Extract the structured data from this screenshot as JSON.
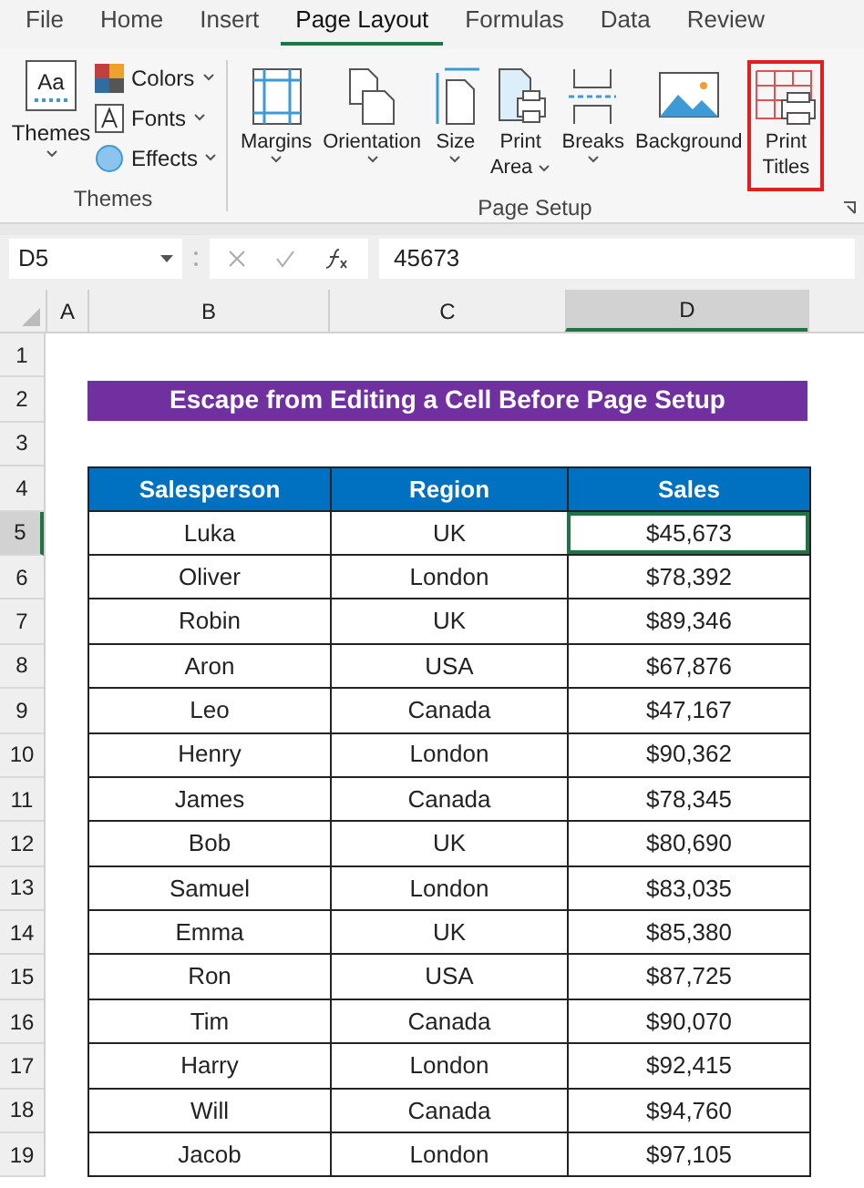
{
  "menu_tabs": [
    {
      "label": "File",
      "selected": false
    },
    {
      "label": "Home",
      "selected": false
    },
    {
      "label": "Insert",
      "selected": false
    },
    {
      "label": "Page Layout",
      "selected": true
    },
    {
      "label": "Formulas",
      "selected": false
    },
    {
      "label": "Data",
      "selected": false
    },
    {
      "label": "Review",
      "selected": false
    }
  ],
  "ribbon": {
    "themes_group": {
      "label": "Themes",
      "themes_button": {
        "icon_text": "Aa",
        "label": "Themes",
        "dropdown": true
      },
      "small_buttons": [
        {
          "label": "Colors",
          "dropdown": true
        },
        {
          "label": "Fonts",
          "dropdown": true
        },
        {
          "label": "Effects",
          "dropdown": true
        }
      ]
    },
    "page_setup_group": {
      "label": "Page Setup",
      "buttons": [
        {
          "lines": [
            "Margins"
          ],
          "dropdown": true,
          "highlighted": false
        },
        {
          "lines": [
            "Orientation"
          ],
          "dropdown": true,
          "highlighted": false
        },
        {
          "lines": [
            "Size"
          ],
          "dropdown": true,
          "highlighted": false
        },
        {
          "lines": [
            "Print",
            "Area"
          ],
          "dropdown": true,
          "highlighted": false
        },
        {
          "lines": [
            "Breaks"
          ],
          "dropdown": true,
          "highlighted": false
        },
        {
          "lines": [
            "Background"
          ],
          "dropdown": false,
          "highlighted": false
        },
        {
          "lines": [
            "Print",
            "Titles"
          ],
          "dropdown": false,
          "highlighted": true
        }
      ]
    }
  },
  "formula_bar": {
    "name_box": "D5",
    "value": "45673"
  },
  "columns": [
    {
      "label": "A",
      "selected": false
    },
    {
      "label": "B",
      "selected": false
    },
    {
      "label": "C",
      "selected": false
    },
    {
      "label": "D",
      "selected": true
    }
  ],
  "row_numbers": [
    {
      "label": "1",
      "selected": false
    },
    {
      "label": "2",
      "selected": false
    },
    {
      "label": "3",
      "selected": false
    },
    {
      "label": "4",
      "selected": false
    },
    {
      "label": "5",
      "selected": true
    },
    {
      "label": "6",
      "selected": false
    },
    {
      "label": "7",
      "selected": false
    },
    {
      "label": "8",
      "selected": false
    },
    {
      "label": "9",
      "selected": false
    },
    {
      "label": "10",
      "selected": false
    },
    {
      "label": "11",
      "selected": false
    },
    {
      "label": "12",
      "selected": false
    },
    {
      "label": "13",
      "selected": false
    },
    {
      "label": "14",
      "selected": false
    },
    {
      "label": "15",
      "selected": false
    },
    {
      "label": "16",
      "selected": false
    },
    {
      "label": "17",
      "selected": false
    },
    {
      "label": "18",
      "selected": false
    },
    {
      "label": "19",
      "selected": false
    }
  ],
  "sheet_title": "Escape from Editing a Cell Before Page Setup",
  "table": {
    "columns": [
      "Salesperson",
      "Region",
      "Sales"
    ],
    "rows": [
      {
        "cells": [
          "Luka",
          "UK",
          "$45,673"
        ],
        "active": [
          false,
          false,
          true
        ]
      },
      {
        "cells": [
          "Oliver",
          "London",
          "$78,392"
        ]
      },
      {
        "cells": [
          "Robin",
          "UK",
          "$89,346"
        ]
      },
      {
        "cells": [
          "Aron",
          "USA",
          "$67,876"
        ]
      },
      {
        "cells": [
          "Leo",
          "Canada",
          "$47,167"
        ]
      },
      {
        "cells": [
          "Henry",
          "London",
          "$90,362"
        ]
      },
      {
        "cells": [
          "James",
          "Canada",
          "$78,345"
        ]
      },
      {
        "cells": [
          "Bob",
          "UK",
          "$80,690"
        ]
      },
      {
        "cells": [
          "Samuel",
          "London",
          "$83,035"
        ]
      },
      {
        "cells": [
          "Emma",
          "UK",
          "$85,380"
        ]
      },
      {
        "cells": [
          "Ron",
          "USA",
          "$87,725"
        ]
      },
      {
        "cells": [
          "Tim",
          "Canada",
          "$90,070"
        ]
      },
      {
        "cells": [
          "Harry",
          "London",
          "$92,415"
        ]
      },
      {
        "cells": [
          "Will",
          "Canada",
          "$94,760"
        ]
      },
      {
        "cells": [
          "Jacob",
          "London",
          "$97,105"
        ]
      }
    ]
  }
}
